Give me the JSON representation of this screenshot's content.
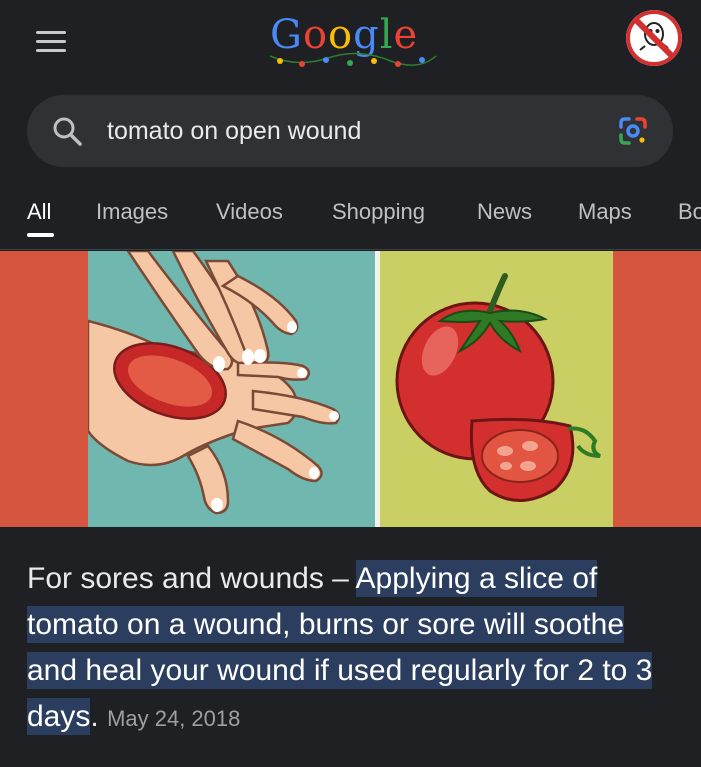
{
  "header": {
    "menu_icon": "hamburger-menu-icon",
    "logo_text": "Google",
    "avatar_icon": "ghostbusters-logo-icon"
  },
  "search": {
    "query": "tomato on open wound",
    "search_icon": "search-icon",
    "lens_icon": "google-lens-icon"
  },
  "tabs": [
    {
      "label": "All",
      "active": true
    },
    {
      "label": "Images",
      "active": false
    },
    {
      "label": "Videos",
      "active": false
    },
    {
      "label": "Shopping",
      "active": false
    },
    {
      "label": "News",
      "active": false
    },
    {
      "label": "Maps",
      "active": false
    },
    {
      "label": "Bo",
      "active": false
    }
  ],
  "result": {
    "snippet_prefix": "For sores and wounds – ",
    "snippet_highlight": "Applying a slice of tomato on a wound, burns or sore will soothe and heal your wound if used regularly for 2 to 3 days",
    "snippet_suffix": ".",
    "date": "May 24, 2018"
  },
  "colors": {
    "background": "#1f2023",
    "search_bar": "#303134",
    "highlight": "#2c3e5f",
    "hero_side": "#d5553e",
    "hero_left_panel": "#6fb7af",
    "hero_right_panel": "#c9cf63"
  }
}
